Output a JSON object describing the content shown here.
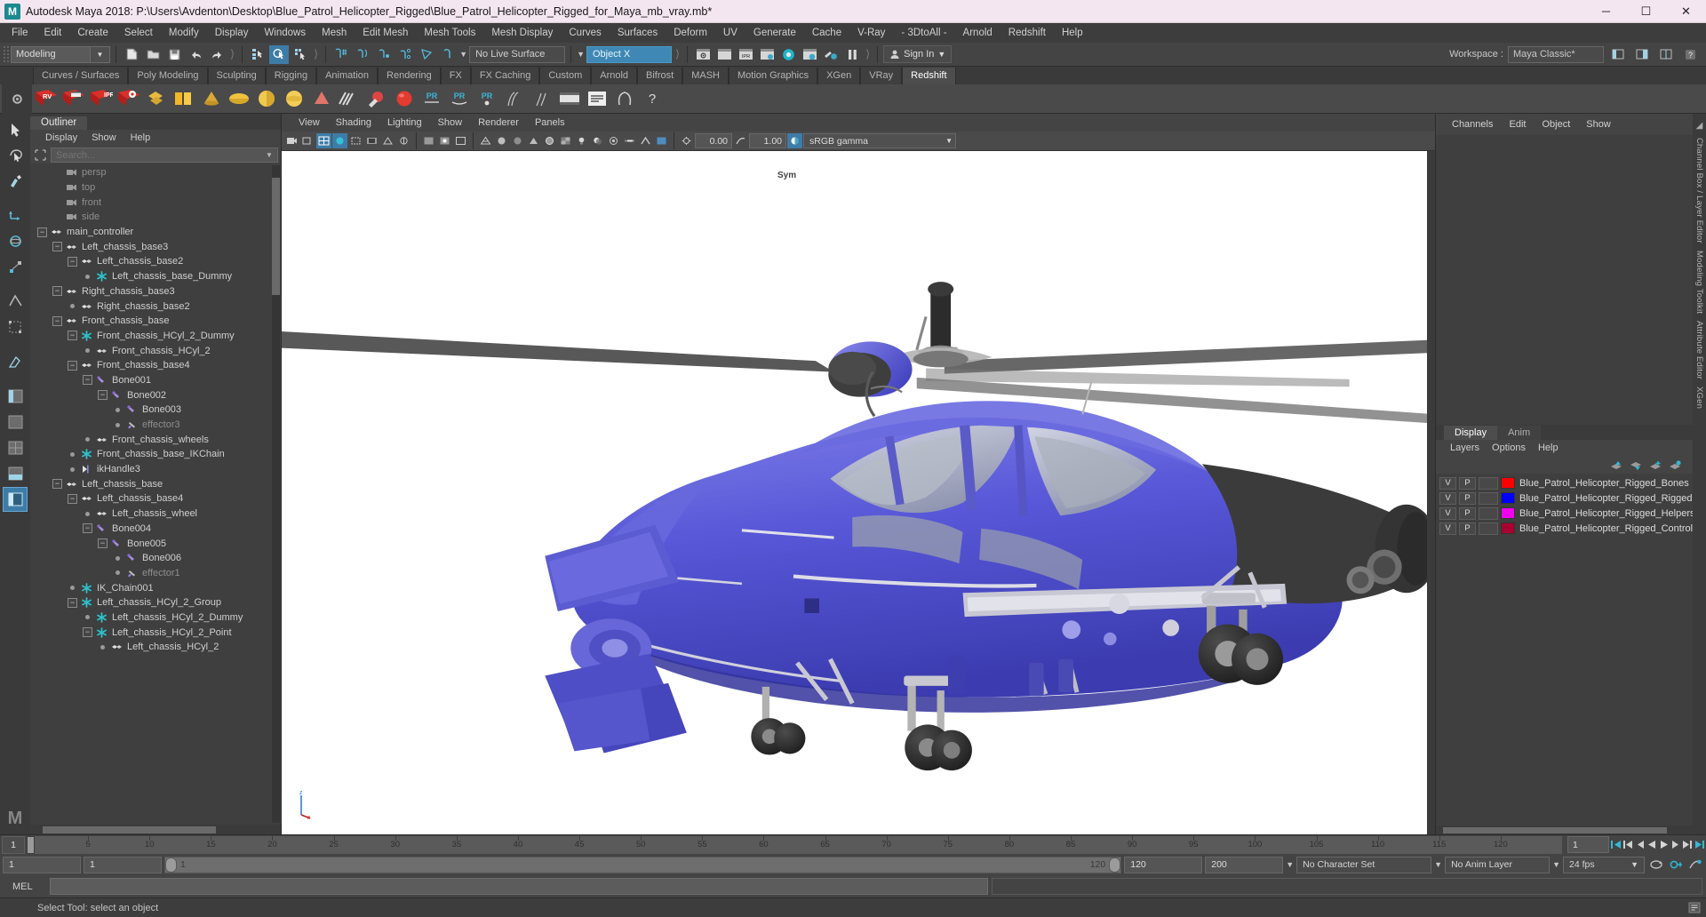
{
  "window": {
    "title": "Autodesk Maya 2018: P:\\Users\\Avdenton\\Desktop\\Blue_Patrol_Helicopter_Rigged\\Blue_Patrol_Helicopter_Rigged_for_Maya_mb_vray.mb*",
    "logo": "M",
    "minimize": "─",
    "maximize": "☐",
    "close": "✕"
  },
  "menubar": {
    "items": [
      "File",
      "Edit",
      "Create",
      "Select",
      "Modify",
      "Display",
      "Windows",
      "Mesh",
      "Edit Mesh",
      "Mesh Tools",
      "Mesh Display",
      "Curves",
      "Surfaces",
      "Deform",
      "UV",
      "Generate",
      "Cache",
      "V-Ray",
      "- 3DtoAll -",
      "Arnold",
      "Redshift",
      "Help"
    ]
  },
  "statusbar": {
    "mode": "Modeling",
    "live_surface": "No Live Surface",
    "object_field": "Object X",
    "signin": "Sign In",
    "workspace_label": "Workspace :",
    "workspace_value": "Maya Classic*",
    "icons": [
      "new-scene-icon",
      "open-scene-icon",
      "save-scene-icon",
      "undo-icon",
      "redo-icon",
      "select-hierarchy-icon",
      "select-object-icon",
      "select-component-icon",
      "snap-grid-icon",
      "snap-curve-icon",
      "snap-point-icon",
      "snap-projected-icon",
      "snap-view-plane-icon",
      "magnet-icon",
      "render-view-icon",
      "render-sequence-icon",
      "ipr-render-icon",
      "render-settings-icon",
      "hypershade-icon",
      "render-setup-icon",
      "light-editor-icon",
      "pause-icon"
    ]
  },
  "shelf": {
    "tabs": [
      "Curves / Surfaces",
      "Poly Modeling",
      "Sculpting",
      "Rigging",
      "Animation",
      "Rendering",
      "FX",
      "FX Caching",
      "Custom",
      "Arnold",
      "Bifrost",
      "MASH",
      "Motion Graphics",
      "XGen",
      "VRay",
      "Redshift"
    ],
    "active_tab": "Redshift",
    "buttons": [
      "rv-icon",
      "render-frame-icon",
      "ipr-icon",
      "redshift-settings-icon",
      "gold-diamond-icon",
      "yellow-block-icon",
      "cone-icon",
      "disc-icon",
      "sphere-slice-icon",
      "gold-sphere-icon",
      "pink-cone-icon",
      "noodle-icon",
      "red-bulb-icon",
      "red-sphere-icon",
      "pr-a-icon",
      "pr-b-icon",
      "pr-c-icon",
      "hair-icon",
      "fur-icon",
      "filmstrip-icon",
      "log-icon",
      "proxy-icon",
      "help-icon"
    ]
  },
  "toolbox": {
    "tools": [
      "select-tool",
      "lasso-select-tool",
      "paint-select-tool",
      "move-tool",
      "rotate-tool",
      "scale-tool",
      "last-tool",
      "show-manipulator-tool",
      "quad-draw-tool",
      "outliner-layout-icon",
      "persp-layout-icon",
      "four-view-layout-icon",
      "persp-outliner-layout-icon",
      "hypershade-layout-icon",
      "persp-graph-layout-icon"
    ],
    "selected": "persp-outliner-layout-icon",
    "brand": "M"
  },
  "outliner": {
    "tab": "Outliner",
    "menu": [
      "Display",
      "Show",
      "Help"
    ],
    "search_placeholder": "Search...",
    "search_value": "",
    "search_icon": "search-icon",
    "items": [
      {
        "label": "persp",
        "depth": 1,
        "icon": "camera-icon",
        "expander": "none",
        "dim": true
      },
      {
        "label": "top",
        "depth": 1,
        "icon": "camera-icon",
        "expander": "none",
        "dim": true
      },
      {
        "label": "front",
        "depth": 1,
        "icon": "camera-icon",
        "expander": "none",
        "dim": true
      },
      {
        "label": "side",
        "depth": 1,
        "icon": "camera-icon",
        "expander": "none",
        "dim": true
      },
      {
        "label": "main_controller",
        "depth": 0,
        "icon": "transform-icon",
        "expander": "minus",
        "dim": false
      },
      {
        "label": "Left_chassis_base3",
        "depth": 1,
        "icon": "transform-icon",
        "expander": "minus",
        "dim": false
      },
      {
        "label": "Left_chassis_base2",
        "depth": 2,
        "icon": "transform-icon",
        "expander": "minus",
        "dim": false
      },
      {
        "label": "Left_chassis_base_Dummy",
        "depth": 3,
        "icon": "joint-star-icon",
        "expander": "dot",
        "dim": false
      },
      {
        "label": "Right_chassis_base3",
        "depth": 1,
        "icon": "transform-icon",
        "expander": "minus",
        "dim": false
      },
      {
        "label": "Right_chassis_base2",
        "depth": 2,
        "icon": "transform-icon",
        "expander": "dot",
        "dim": false
      },
      {
        "label": "Front_chassis_base",
        "depth": 1,
        "icon": "transform-icon",
        "expander": "minus",
        "dim": false
      },
      {
        "label": "Front_chassis_HCyl_2_Dummy",
        "depth": 2,
        "icon": "joint-star-icon",
        "expander": "minus",
        "dim": false
      },
      {
        "label": "Front_chassis_HCyl_2",
        "depth": 3,
        "icon": "transform-icon",
        "expander": "dot",
        "dim": false
      },
      {
        "label": "Front_chassis_base4",
        "depth": 2,
        "icon": "transform-icon",
        "expander": "minus",
        "dim": false
      },
      {
        "label": "Bone001",
        "depth": 3,
        "icon": "bone-icon",
        "expander": "minus",
        "dim": false
      },
      {
        "label": "Bone002",
        "depth": 4,
        "icon": "bone-icon",
        "expander": "minus",
        "dim": false
      },
      {
        "label": "Bone003",
        "depth": 5,
        "icon": "bone-icon",
        "expander": "dot",
        "dim": false
      },
      {
        "label": "effector3",
        "depth": 5,
        "icon": "effector-icon",
        "expander": "dot",
        "dim": true
      },
      {
        "label": "Front_chassis_wheels",
        "depth": 3,
        "icon": "transform-icon",
        "expander": "dot",
        "dim": false
      },
      {
        "label": "Front_chassis_base_IKChain",
        "depth": 2,
        "icon": "joint-star-icon",
        "expander": "dot",
        "dim": false
      },
      {
        "label": "ikHandle3",
        "depth": 2,
        "icon": "ikhandle-icon",
        "expander": "dot",
        "dim": false
      },
      {
        "label": "Left_chassis_base",
        "depth": 1,
        "icon": "transform-icon",
        "expander": "minus",
        "dim": false
      },
      {
        "label": "Left_chassis_base4",
        "depth": 2,
        "icon": "transform-icon",
        "expander": "minus",
        "dim": false
      },
      {
        "label": "Left_chassis_wheel",
        "depth": 3,
        "icon": "transform-icon",
        "expander": "dot",
        "dim": false
      },
      {
        "label": "Bone004",
        "depth": 3,
        "icon": "bone-icon",
        "expander": "minus",
        "dim": false
      },
      {
        "label": "Bone005",
        "depth": 4,
        "icon": "bone-icon",
        "expander": "minus",
        "dim": false
      },
      {
        "label": "Bone006",
        "depth": 5,
        "icon": "bone-icon",
        "expander": "dot",
        "dim": false
      },
      {
        "label": "effector1",
        "depth": 5,
        "icon": "effector-icon",
        "expander": "dot",
        "dim": true
      },
      {
        "label": "IK_Chain001",
        "depth": 2,
        "icon": "joint-star-icon",
        "expander": "dot",
        "dim": false
      },
      {
        "label": "Left_chassis_HCyl_2_Group",
        "depth": 2,
        "icon": "joint-star-icon",
        "expander": "minus",
        "dim": false
      },
      {
        "label": "Left_chassis_HCyl_2_Dummy",
        "depth": 3,
        "icon": "joint-star-icon",
        "expander": "dot",
        "dim": false
      },
      {
        "label": "Left_chassis_HCyl_2_Point",
        "depth": 3,
        "icon": "joint-star-icon",
        "expander": "minus",
        "dim": false
      },
      {
        "label": "Left_chassis_HCyl_2",
        "depth": 4,
        "icon": "transform-icon",
        "expander": "dot",
        "dim": false
      }
    ]
  },
  "viewport": {
    "menu": [
      "View",
      "Shading",
      "Lighting",
      "Show",
      "Renderer",
      "Panels"
    ],
    "exposure": "0.00",
    "gamma": "1.00",
    "color_space": "sRGB gamma",
    "label_sym": "Sym",
    "axis": {
      "y": "z",
      "x": "x"
    },
    "tool_icons": [
      "select-camera-icon",
      "grid-toggle-icon",
      "film-gate-icon",
      "resolution-gate-icon",
      "gate-mask-icon",
      "film-origin-icon",
      "xray-icon",
      "xray-joints-icon",
      "wireframe-icon",
      "smooth-shade-icon",
      "flat-shade-icon",
      "shaded-textured-icon",
      "lights-icon",
      "shadows-icon",
      "ao-icon",
      "motion-blur-icon",
      "aa-icon",
      "exposure-icon",
      "gamma-icon",
      "color-mgmt-icon"
    ]
  },
  "channelbox": {
    "menu": [
      "Channels",
      "Edit",
      "Object",
      "Show"
    ]
  },
  "layers": {
    "tabs": [
      "Display",
      "Anim"
    ],
    "active_tab": "Display",
    "menu": [
      "Layers",
      "Options",
      "Help"
    ],
    "buttons": [
      "move-layer-up-icon",
      "move-layer-down-icon",
      "new-layer-icon",
      "new-layer-from-selected-icon"
    ],
    "rows": [
      {
        "v": "V",
        "p": "P",
        "color": "#ff0000",
        "name": "Blue_Patrol_Helicopter_Rigged_Bones"
      },
      {
        "v": "V",
        "p": "P",
        "color": "#0000ff",
        "name": "Blue_Patrol_Helicopter_Rigged_Rigged"
      },
      {
        "v": "V",
        "p": "P",
        "color": "#ee00ee",
        "name": "Blue_Patrol_Helicopter_Rigged_Helpers"
      },
      {
        "v": "V",
        "p": "P",
        "color": "#a80030",
        "name": "Blue_Patrol_Helicopter_Rigged_Controllers"
      }
    ]
  },
  "rail": {
    "labels": [
      "Channel Box / Layer Editor",
      "Modeling Toolkit",
      "Attribute Editor",
      "XGen"
    ]
  },
  "timeslider": {
    "start_display": "1",
    "current_frame": "1",
    "ticks": [
      5,
      10,
      15,
      20,
      25,
      30,
      35,
      40,
      45,
      50,
      55,
      60,
      65,
      70,
      75,
      80,
      85,
      90,
      95,
      100,
      105,
      110,
      115,
      120
    ],
    "end_field": "1",
    "playback_buttons": [
      "go-to-start-icon",
      "step-back-key-icon",
      "step-back-frame-icon",
      "play-backwards-icon",
      "play-forwards-icon",
      "step-forward-frame-icon",
      "step-forward-key-icon",
      "go-to-end-icon"
    ]
  },
  "rangebar": {
    "anim_start": "1",
    "range_start": "1",
    "slider_left_label": "1",
    "slider_right_label": "120",
    "range_end": "120",
    "anim_end": "200",
    "character_set": "No Character Set",
    "anim_layer": "No Anim Layer",
    "fps": "24 fps",
    "icons": [
      "auto-key-icon",
      "animation-preferences-icon",
      "playback-loop-icon"
    ]
  },
  "mel": {
    "label": "MEL",
    "command_value": ""
  },
  "status": {
    "message": "Select Tool: select an object"
  }
}
